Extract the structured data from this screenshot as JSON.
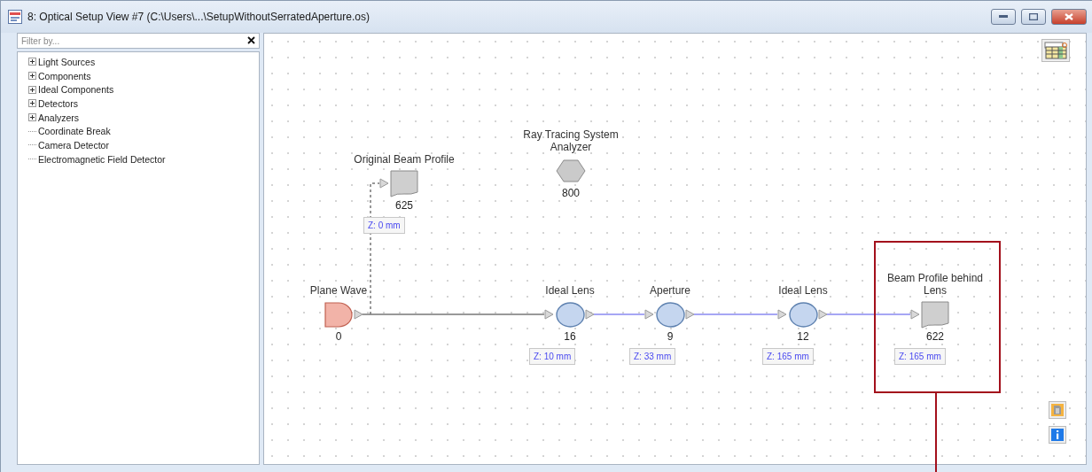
{
  "window": {
    "title": "8: Optical Setup View #7 (C:\\Users\\...\\SetupWithoutSerratedAperture.os)"
  },
  "filter": {
    "placeholder": "Filter by..."
  },
  "tree": [
    {
      "label": "Light Sources",
      "kind": "group"
    },
    {
      "label": "Components",
      "kind": "group"
    },
    {
      "label": "Ideal Components",
      "kind": "group"
    },
    {
      "label": "Detectors",
      "kind": "group"
    },
    {
      "label": "Analyzers",
      "kind": "group"
    },
    {
      "label": "Coordinate Break",
      "kind": "leaf"
    },
    {
      "label": "Camera Detector",
      "kind": "leaf"
    },
    {
      "label": "Electromagnetic Field Detector",
      "kind": "leaf"
    }
  ],
  "nodes": [
    {
      "kind": "source",
      "label": "Plane Wave",
      "number": "0",
      "highlighted": false
    },
    {
      "kind": "detector",
      "label": "Original Beam Profile",
      "number": "625",
      "z": "Z: 0 mm",
      "highlighted": false
    },
    {
      "kind": "analyzer",
      "label": "Ray Tracing System Analyzer",
      "number": "800",
      "highlighted": false
    },
    {
      "kind": "lens",
      "label": "Ideal Lens",
      "number": "16",
      "z": "Z: 10 mm",
      "highlighted": false
    },
    {
      "kind": "lens",
      "label": "Aperture",
      "number": "9",
      "z": "Z: 33 mm",
      "highlighted": false
    },
    {
      "kind": "lens",
      "label": "Ideal Lens",
      "number": "12",
      "z": "Z: 165 mm",
      "highlighted": false
    },
    {
      "kind": "detector",
      "label": "Beam Profile behind Lens",
      "number": "622",
      "z": "Z: 165 mm",
      "highlighted": true
    }
  ]
}
